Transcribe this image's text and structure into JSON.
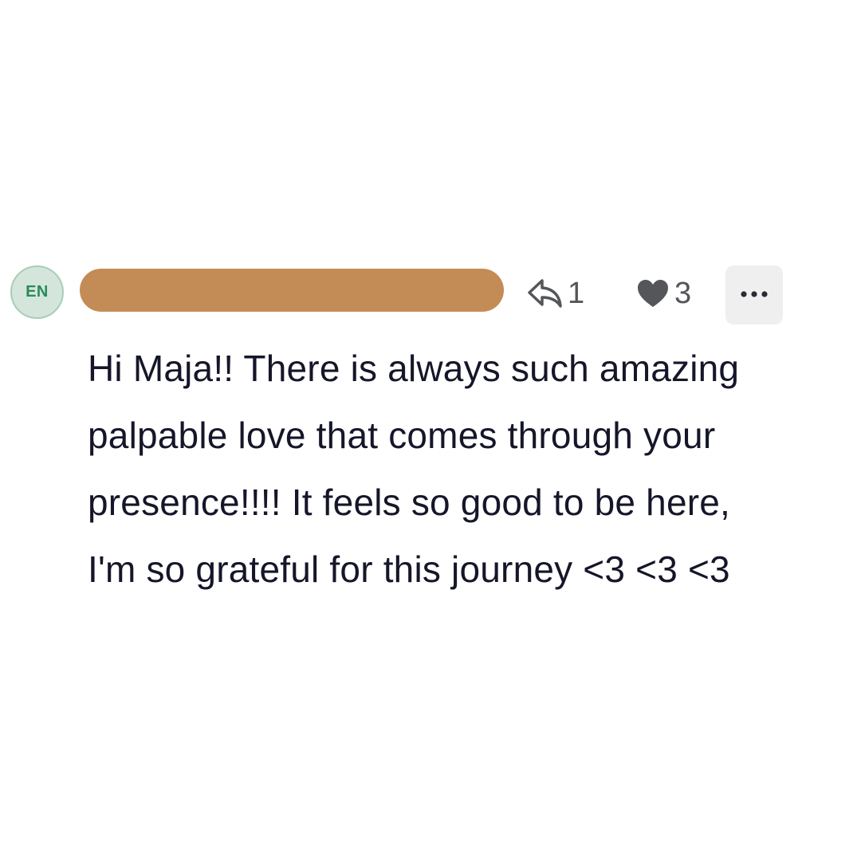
{
  "comment": {
    "avatar_initials": "EN",
    "reply_count": "1",
    "like_count": "3",
    "body_lines": [
      "Hi Maja!! There is always such amazing",
      "palpable love that comes through your",
      "presence!!!! It feels so good to be here,",
      "I'm so grateful for this journey <3 <3 <3"
    ]
  },
  "icons": {
    "reply": "reply-arrow-icon",
    "like": "heart-icon",
    "more": "ellipsis-icon"
  },
  "colors": {
    "avatar_bg": "#d4e6dc",
    "avatar_text": "#2a8a5a",
    "redaction": "#c38c56",
    "icon": "#555659",
    "text": "#16162a",
    "more_bg": "#efeff0"
  }
}
